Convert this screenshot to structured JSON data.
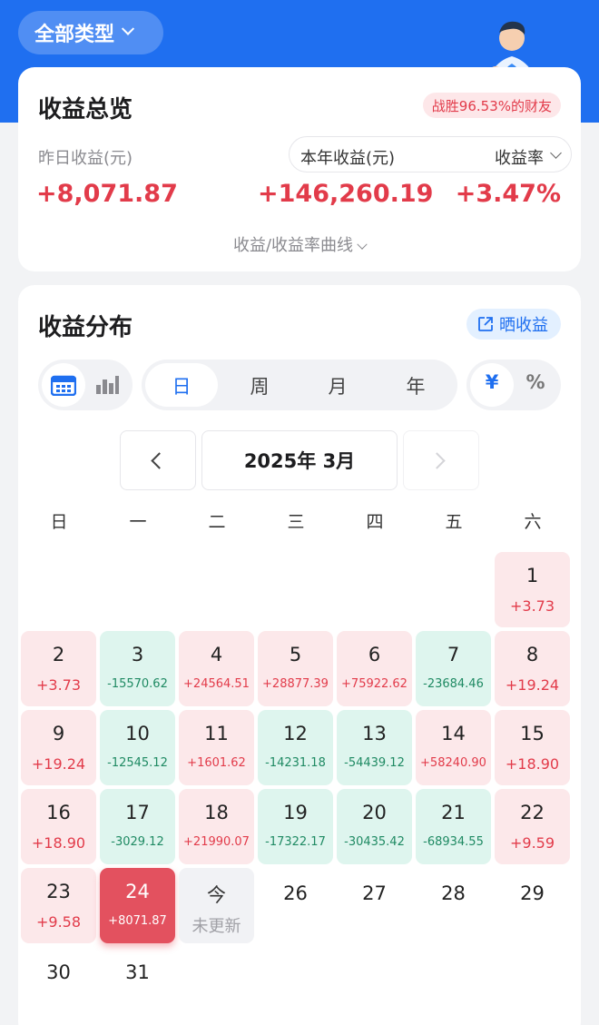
{
  "header": {
    "type_select_label": "全部类型",
    "colors": {
      "brand": "#1f6ff0",
      "up": "#e23b4a",
      "down": "#1f8a63"
    }
  },
  "overview": {
    "title": "收益总览",
    "rank_badge": "战胜96.53%的财友",
    "yesterday_label": "昨日收益(元)",
    "year_label": "本年收益(元)",
    "rate_label": "收益率",
    "yesterday_value": "+8,071.87",
    "year_value": "+146,260.19",
    "rate_value": "+3.47%",
    "curve_link": "收益/收益率曲线"
  },
  "distribution": {
    "title": "收益分布",
    "share_label": "晒收益",
    "view_icons": [
      "calendar-icon",
      "bar-chart-icon"
    ],
    "periods": [
      "日",
      "周",
      "月",
      "年"
    ],
    "period_selected": "日",
    "units": [
      "¥",
      "%"
    ],
    "unit_selected": "¥",
    "month_label": "2025年 3月",
    "weekdays": [
      "日",
      "一",
      "二",
      "三",
      "四",
      "五",
      "六"
    ],
    "days": [
      {
        "day": "1",
        "amount": "+3.73",
        "kind": "pos"
      },
      {
        "day": "2",
        "amount": "+3.73",
        "kind": "pos"
      },
      {
        "day": "3",
        "amount": "-15570.62",
        "kind": "neg"
      },
      {
        "day": "4",
        "amount": "+24564.51",
        "kind": "pos"
      },
      {
        "day": "5",
        "amount": "+28877.39",
        "kind": "pos"
      },
      {
        "day": "6",
        "amount": "+75922.62",
        "kind": "pos"
      },
      {
        "day": "7",
        "amount": "-23684.46",
        "kind": "neg"
      },
      {
        "day": "8",
        "amount": "+19.24",
        "kind": "pos"
      },
      {
        "day": "9",
        "amount": "+19.24",
        "kind": "pos"
      },
      {
        "day": "10",
        "amount": "-12545.12",
        "kind": "neg"
      },
      {
        "day": "11",
        "amount": "+1601.62",
        "kind": "pos"
      },
      {
        "day": "12",
        "amount": "-14231.18",
        "kind": "neg"
      },
      {
        "day": "13",
        "amount": "-54439.12",
        "kind": "neg"
      },
      {
        "day": "14",
        "amount": "+58240.90",
        "kind": "pos"
      },
      {
        "day": "15",
        "amount": "+18.90",
        "kind": "pos"
      },
      {
        "day": "16",
        "amount": "+18.90",
        "kind": "pos"
      },
      {
        "day": "17",
        "amount": "-3029.12",
        "kind": "neg"
      },
      {
        "day": "18",
        "amount": "+21990.07",
        "kind": "pos"
      },
      {
        "day": "19",
        "amount": "-17322.17",
        "kind": "neg"
      },
      {
        "day": "20",
        "amount": "-30435.42",
        "kind": "neg"
      },
      {
        "day": "21",
        "amount": "-68934.55",
        "kind": "neg"
      },
      {
        "day": "22",
        "amount": "+9.59",
        "kind": "pos"
      },
      {
        "day": "23",
        "amount": "+9.58",
        "kind": "pos"
      },
      {
        "day": "24",
        "amount": "+8071.87",
        "kind": "sel"
      },
      {
        "day": "今",
        "amount": "未更新",
        "kind": "today"
      },
      {
        "day": "26",
        "amount": "",
        "kind": "plain"
      },
      {
        "day": "27",
        "amount": "",
        "kind": "plain"
      },
      {
        "day": "28",
        "amount": "",
        "kind": "plain"
      },
      {
        "day": "29",
        "amount": "",
        "kind": "plain"
      },
      {
        "day": "30",
        "amount": "",
        "kind": "plain"
      },
      {
        "day": "31",
        "amount": "",
        "kind": "plain"
      }
    ]
  }
}
